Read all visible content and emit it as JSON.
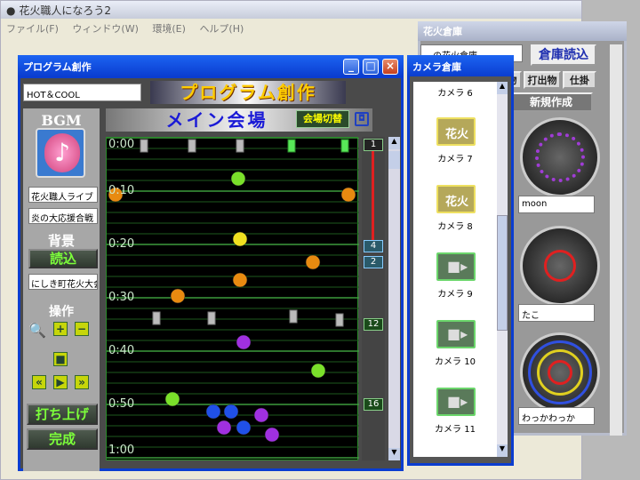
{
  "app": {
    "title": "花火職人になろう2",
    "menu": [
      "ファイル(F)",
      "ウィンドウ(W)",
      "環境(E)",
      "ヘルプ(H)"
    ]
  },
  "program": {
    "window_title": "プログラム創作",
    "show_name": "HOT＆COOL",
    "banner": "プログラム創作",
    "bgm_label": "BGM",
    "bgm_tracks": [
      "花火職人ライブ",
      "炎の大応援合戦"
    ],
    "background_label": "背景",
    "load_label": "読込",
    "background_value": "にしき町花火大会",
    "operation_label": "操作",
    "launch_label": "打ち上げ",
    "done_label": "完成",
    "stage_title": "メイン会場",
    "switch_label": "会場切替",
    "time_labels": [
      "0:00",
      "0:10",
      "0:20",
      "0:30",
      "0:40",
      "0:50",
      "1:00"
    ],
    "timeline_markers": [
      "1",
      "4",
      "2",
      "12",
      "16"
    ]
  },
  "camera": {
    "window_title": "カメラ倉庫",
    "items": [
      {
        "label": "カメラ 6",
        "type": "none"
      },
      {
        "label": "カメラ 7",
        "type": "fire",
        "tag": "花火"
      },
      {
        "label": "カメラ 8",
        "type": "fire",
        "tag": "花火"
      },
      {
        "label": "カメラ 9",
        "type": "cam"
      },
      {
        "label": "カメラ 10",
        "type": "cam"
      },
      {
        "label": "カメラ 11",
        "type": "cam"
      }
    ]
  },
  "warehouse": {
    "window_title": "花火倉庫",
    "partial_field": "…の花火倉庫",
    "load_label": "倉庫読込",
    "tabs": [
      "物",
      "打出物",
      "仕掛"
    ],
    "new_label": "新規作成",
    "shells": [
      {
        "name": "moon"
      },
      {
        "name": "たこ"
      },
      {
        "name": "わっかわっか"
      }
    ]
  }
}
